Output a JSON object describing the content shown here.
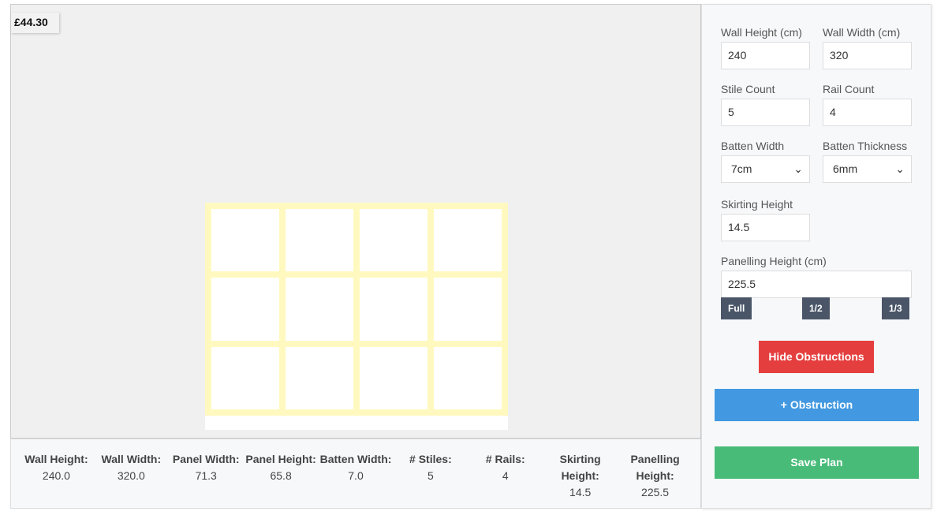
{
  "price": "£44.30",
  "panel": {
    "rows": 3,
    "cols": 4,
    "batten_color": "#fff9c0"
  },
  "stats": [
    {
      "label": "Wall Height:",
      "value": "240.0"
    },
    {
      "label": "Wall Width:",
      "value": "320.0"
    },
    {
      "label": "Panel Width:",
      "value": "71.3"
    },
    {
      "label": "Panel Height:",
      "value": "65.8"
    },
    {
      "label": "Batten Width:",
      "value": "7.0"
    },
    {
      "label": "# Stiles:",
      "value": "5"
    },
    {
      "label": "# Rails:",
      "value": "4"
    },
    {
      "label": "Skirting Height:",
      "value": "14.5"
    },
    {
      "label": "Panelling Height:",
      "value": "225.5"
    }
  ],
  "form": {
    "wall_height": {
      "label": "Wall Height (cm)",
      "value": "240"
    },
    "wall_width": {
      "label": "Wall Width (cm)",
      "value": "320"
    },
    "stile_count": {
      "label": "Stile Count",
      "value": "5"
    },
    "rail_count": {
      "label": "Rail Count",
      "value": "4"
    },
    "batten_width": {
      "label": "Batten Width",
      "value": "7cm"
    },
    "batten_thickness": {
      "label": "Batten Thickness",
      "value": "6mm"
    },
    "skirting_height": {
      "label": "Skirting Height",
      "value": "14.5"
    },
    "panelling_height": {
      "label": "Panelling Height (cm)",
      "value": "225.5"
    },
    "presets": [
      "Full",
      "1/2",
      "1/3"
    ]
  },
  "buttons": {
    "hide": "Hide Obstructions",
    "add": "+ Obstruction",
    "save": "Save Plan"
  },
  "colors": {
    "hide": "#e53e3e",
    "add": "#4299e1",
    "save": "#48bb78"
  }
}
